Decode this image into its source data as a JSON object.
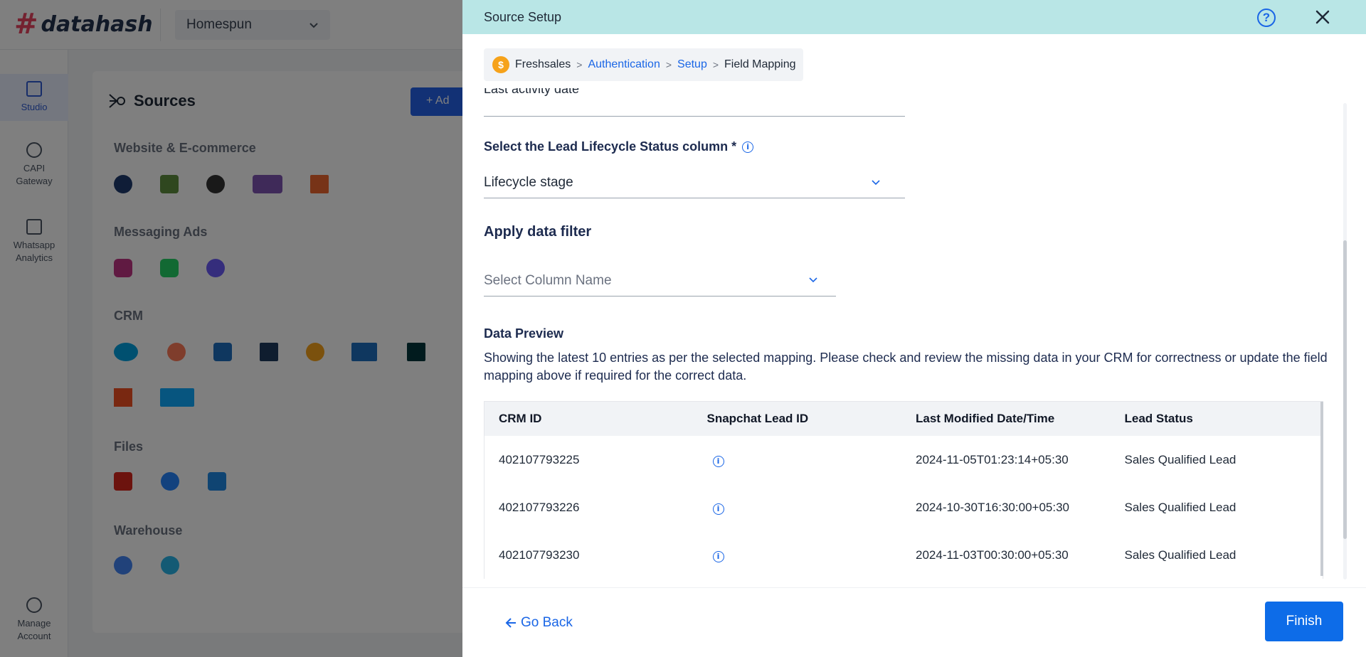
{
  "app": {
    "logo_text": "datahash",
    "workspace": "Homespun",
    "nav": [
      {
        "label": "Studio"
      },
      {
        "label": "CAPI Gateway"
      },
      {
        "label": "Whatsapp Analytics"
      },
      {
        "label": "Manage Account"
      }
    ],
    "sources_title": "Sources",
    "add_label": "Ad",
    "categories": [
      "Website & E-commerce",
      "Messaging Ads",
      "CRM",
      "Files",
      "Warehouse"
    ]
  },
  "drawer": {
    "title": "Source Setup",
    "help_icon": "question-circle-icon",
    "close_icon": "close-icon",
    "breadcrumb": {
      "source": "Freshsales",
      "steps": [
        "Authentication",
        "Setup"
      ],
      "current": "Field Mapping"
    },
    "partial_field_value": "Last activity date",
    "lifecycle": {
      "label": "Select the Lead Lifecycle Status column *",
      "value": "Lifecycle stage"
    },
    "filter": {
      "title": "Apply data filter",
      "placeholder": "Select Column Name"
    },
    "preview": {
      "title": "Data Preview",
      "description": "Showing the latest 10 entries as per the selected mapping. Please check and review the missing data in your CRM for correctness or update the field mapping above if required for the correct data.",
      "columns": [
        "CRM ID",
        "Snapchat Lead ID",
        "Last Modified Date/Time",
        "Lead Status"
      ],
      "rows": [
        {
          "crm_id": "402107793225",
          "modified": "2024-11-05T01:23:14+05:30",
          "status": "Sales Qualified Lead"
        },
        {
          "crm_id": "402107793226",
          "modified": "2024-10-30T16:30:00+05:30",
          "status": "Sales Qualified Lead"
        },
        {
          "crm_id": "402107793230",
          "modified": "2024-11-03T00:30:00+05:30",
          "status": "Sales Qualified Lead"
        }
      ]
    },
    "footer": {
      "back_label": "Go Back",
      "finish_label": "Finish"
    }
  }
}
